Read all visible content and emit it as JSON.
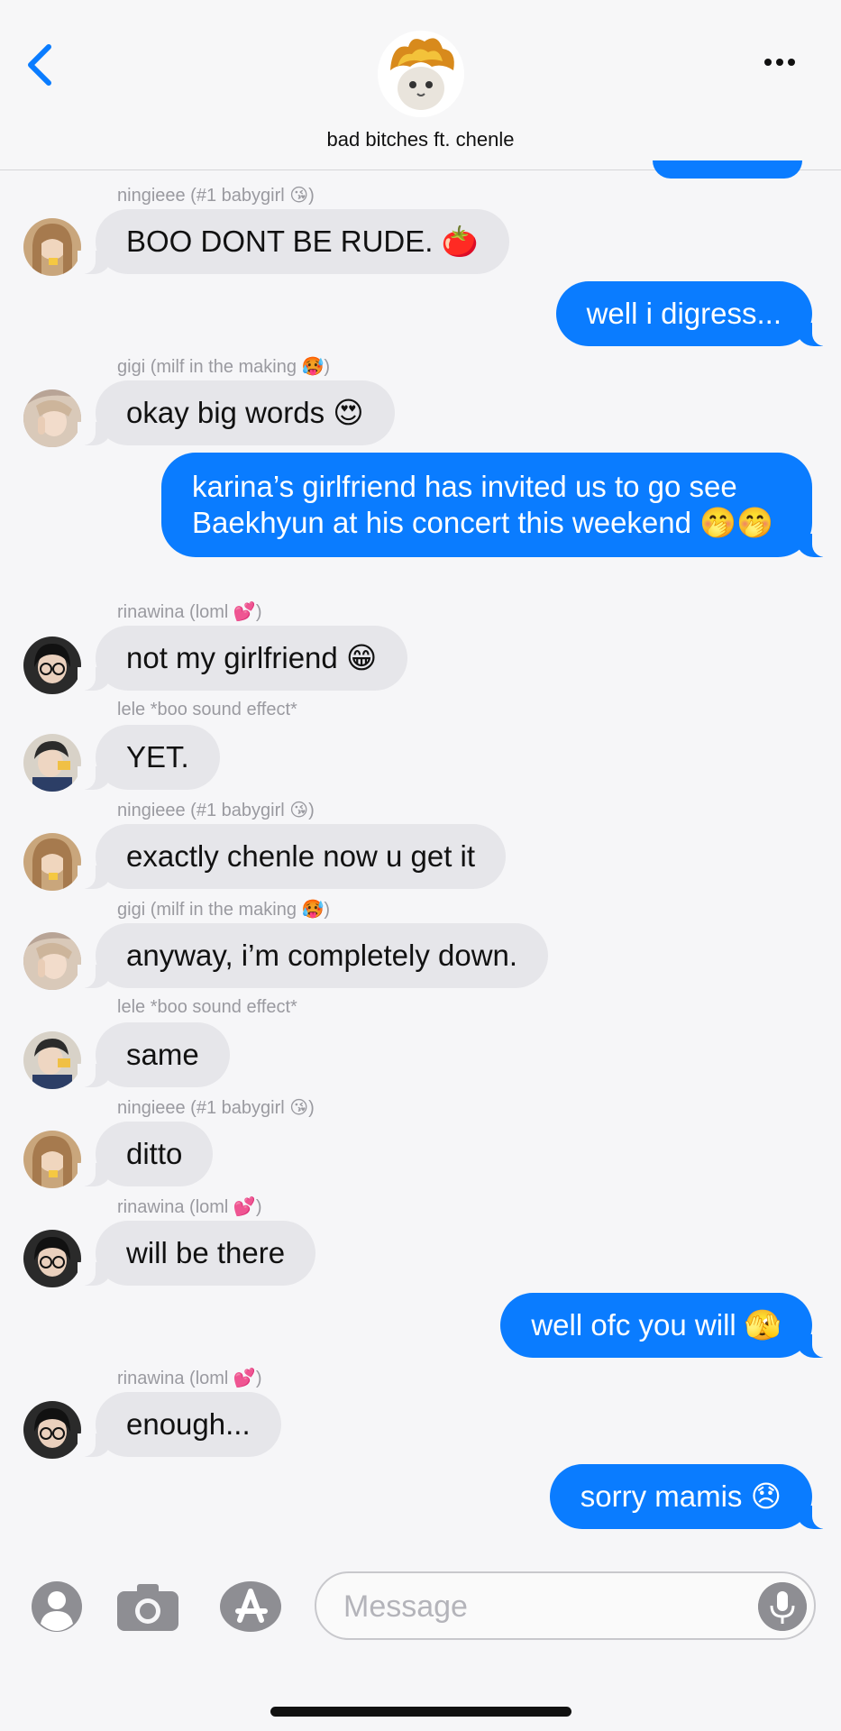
{
  "header": {
    "group_name": "bad bitches ft. chenle",
    "back_icon": "chevron-left-icon",
    "more_icon": "ellipsis-icon",
    "accent_color": "#0a7cff"
  },
  "senders": {
    "ningieee": "ningieee (#1 babygirl 😘)",
    "gigi": "gigi (milf in the making 🥵)",
    "rinawina": "rinawina (loml 💕)",
    "lele": "lele *boo sound effect*"
  },
  "messages": {
    "m1": "BOO DONT BE RUDE. 🍅",
    "m2": "well i digress...",
    "m3": "okay big words 😍",
    "m4": "karina’s girlfriend has invited us to go see Baekhyun at his concert this weekend 🤭🤭",
    "m5": "not my girlfriend 😁",
    "m6": "YET.",
    "m7": "exactly chenle now u get it",
    "m8": "anyway, i’m completely down.",
    "m9": "same",
    "m10": "ditto",
    "m11": "will be there",
    "m12": "well ofc you will 🫣",
    "m13": "enough...",
    "m14": "sorry mamis 😞"
  },
  "input": {
    "placeholder": "Message",
    "contact_icon": "person-icon",
    "camera_icon": "camera-icon",
    "appstore_icon": "app-store-icon",
    "mic_icon": "microphone-icon"
  },
  "colors": {
    "sent_bubble": "#0a7cff",
    "received_bubble": "#e6e6ea",
    "background": "#f6f6f8"
  }
}
